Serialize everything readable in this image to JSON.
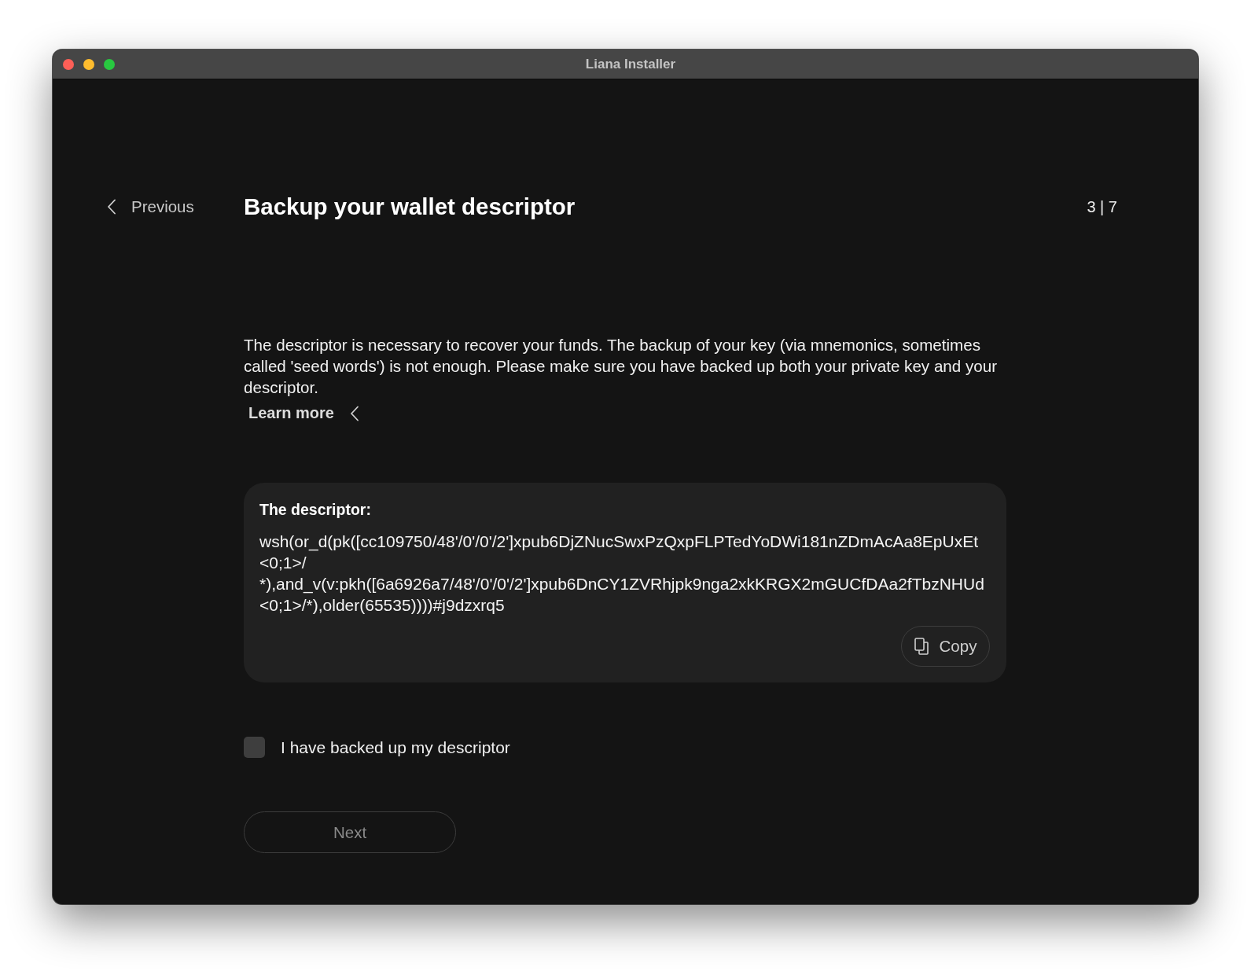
{
  "window": {
    "title": "Liana Installer"
  },
  "header": {
    "back_button": "Previous",
    "title": "Backup your wallet descriptor",
    "step": "3 | 7"
  },
  "intro": {
    "text": "The descriptor is necessary to recover your funds. The backup of your key (via mnemonics, sometimes called 'seed words') is not enough. Please make sure you have backed up both your private key and your descriptor.",
    "link": "Learn more"
  },
  "descriptor": {
    "label": "The descriptor:",
    "lines": [
      "wsh(or_d(pk([cc109750/48'/0'/0'/2']xpub6DjZNucSwxPzQxpFLPTedYoDWi181nZDmAcAa8EpUxEt",
      "<0;1>/",
      "*),and_v(v:pkh([6a6926a7/48'/0'/0'/2']xpub6DnCY1ZVRhjpk9nga2xkKRGX2mGUCfDAa2fTbzNHUd",
      "<0;1>/*),older(65535))))#j9dzxrq5"
    ],
    "copy_button": "Copy"
  },
  "confirm": {
    "label": "I have backed up my descriptor",
    "checked": false
  },
  "next_button": {
    "label": "Next",
    "disabled": true
  }
}
